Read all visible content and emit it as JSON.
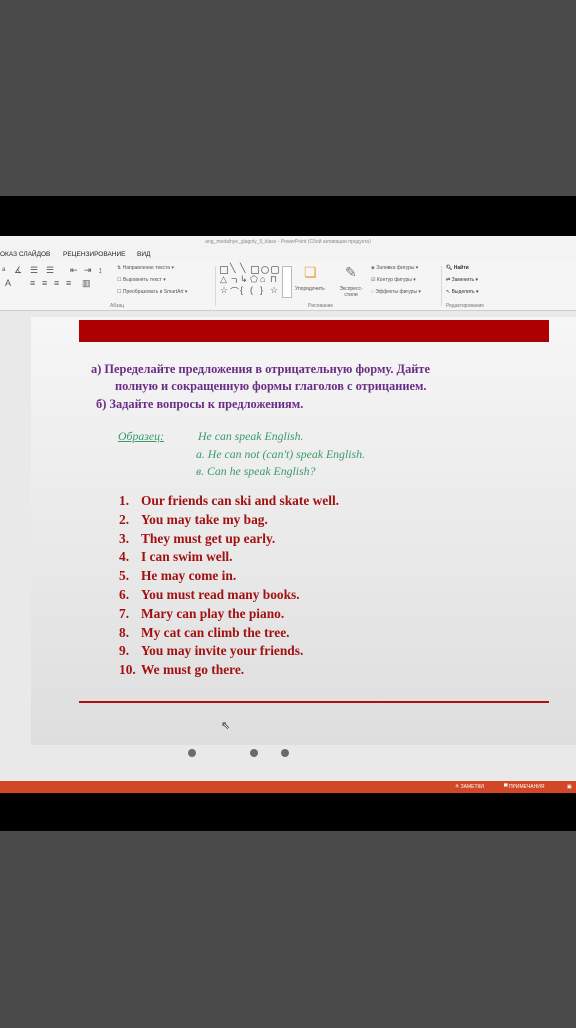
{
  "window": {
    "title": "ang_modalnye_glagoly_5_klass - PowerPoint (Сбой активации продукта)"
  },
  "tabs": [
    {
      "label": "ОКАЗ СЛАЙДОВ"
    },
    {
      "label": "РЕЦЕНЗИРОВАНИЕ"
    },
    {
      "label": "ВИД"
    }
  ],
  "ribbon": {
    "paragraph": {
      "text_direction": "Направление текста",
      "align_text": "Выровнять текст",
      "smartart": "Преобразовать в SmartArt",
      "group_label": "Абзац"
    },
    "drawing": {
      "arrange": "Упорядочить",
      "quick_styles": "Экспресс-стили",
      "shape_fill": "Заливка фигуры",
      "shape_outline": "Контур фигуры",
      "shape_effects": "Эффекты фигуры",
      "group_label": "Рисование"
    },
    "editing": {
      "find": "Найти",
      "replace": "Заменить",
      "select": "Выделить",
      "group_label": "Редактирование"
    }
  },
  "slide": {
    "task_a_line1": "а)  Переделайте предложения в отрицательную форму. Дайте",
    "task_a_line2": "полную и сокращенную формы глаголов с отрицанием.",
    "task_b": "б)  Задайте вопросы к предложениям.",
    "example_label": "Образец:",
    "example_sentence": "He can speak English.",
    "example_a": "а.  He can not (can't) speak English.",
    "example_b": "в.   Can he speak English?",
    "sentences": [
      {
        "num": "1.",
        "text": "Our friends can ski and skate well."
      },
      {
        "num": "2.",
        "text": "You may take my bag."
      },
      {
        "num": "3.",
        "text": "They must get up early."
      },
      {
        "num": "4.",
        "text": "I can swim well."
      },
      {
        "num": "5.",
        "text": "He may come in."
      },
      {
        "num": "6.",
        "text": "You must read many books."
      },
      {
        "num": "7.",
        "text": "Mary can play the piano."
      },
      {
        "num": "8.",
        "text": "My cat can climb the tree."
      },
      {
        "num": "9.",
        "text": "You may invite your friends."
      },
      {
        "num": "10.",
        "text": "We must go there."
      }
    ]
  },
  "status_bar": {
    "notes": "ЗАМЕТКИ",
    "comments": "ПРИМЕЧАНИЯ"
  },
  "colors": {
    "accent_red": "#ad0000",
    "task_purple": "#6a2d86",
    "example_green": "#3a9a6a",
    "sentence_red": "#a31010",
    "status_bar": "#d24726"
  }
}
